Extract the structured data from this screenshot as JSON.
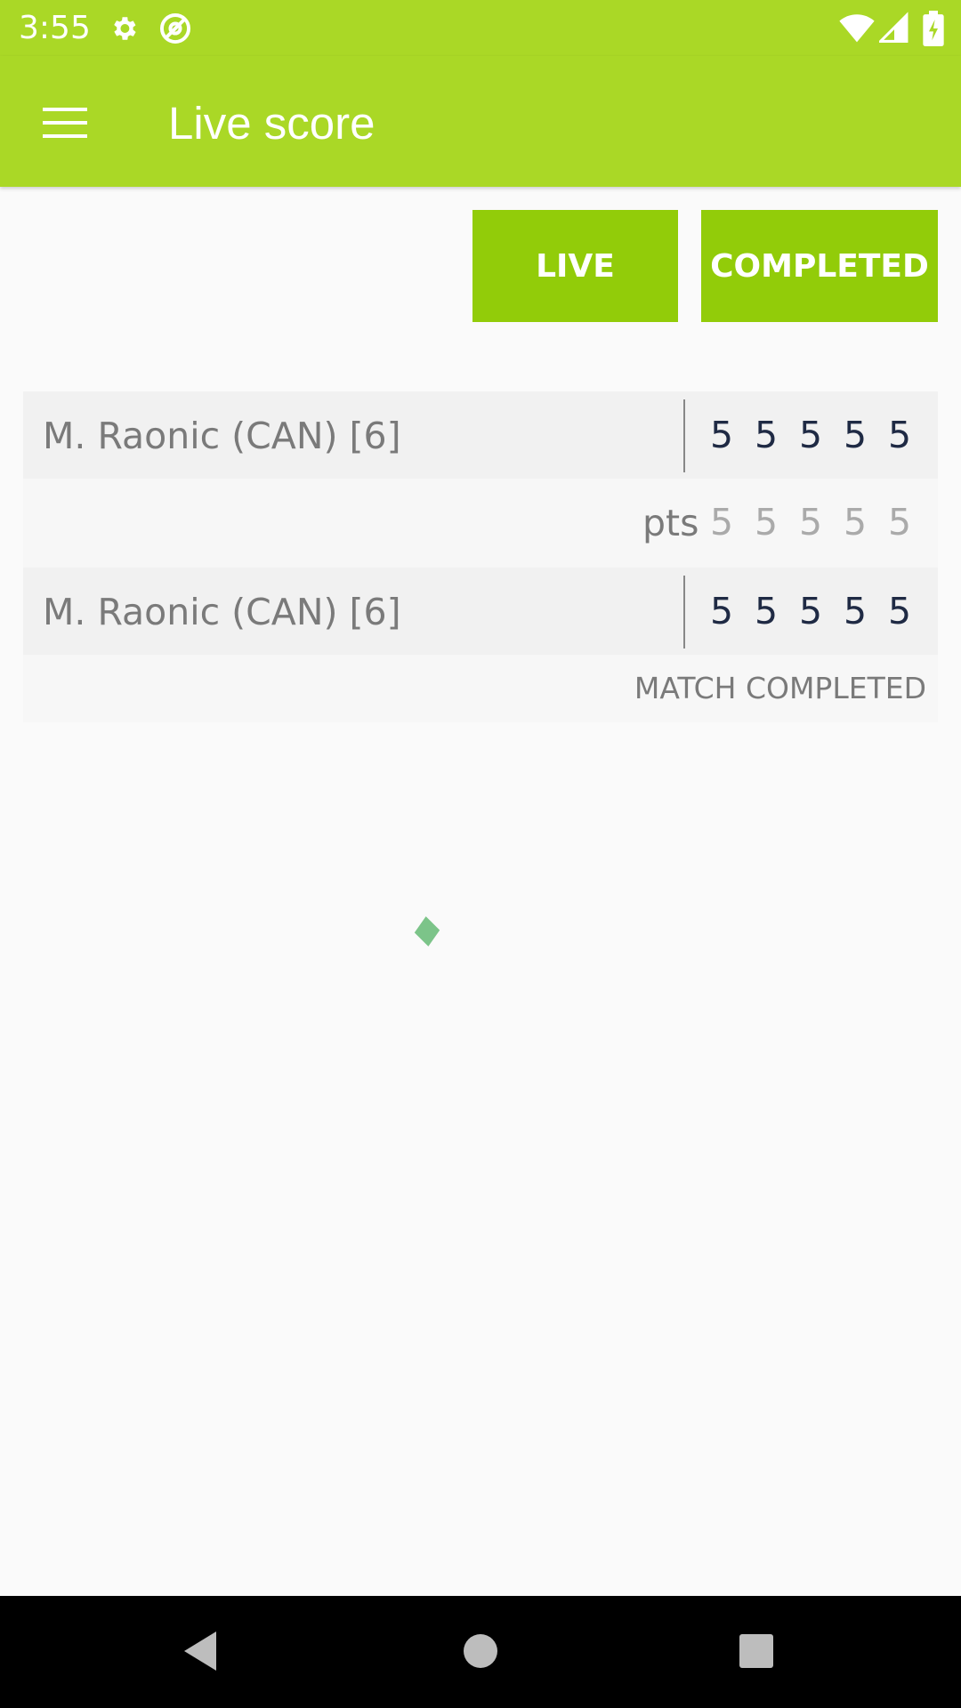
{
  "status_bar": {
    "time": "3:55",
    "icons": [
      "settings-icon",
      "at-sign-icon",
      "wifi-icon",
      "signal-icon",
      "battery-icon"
    ]
  },
  "app_bar": {
    "title": "Live score",
    "menu_icon": "hamburger-menu-icon"
  },
  "tabs": {
    "live_label": "LIVE",
    "completed_label": "COMPLETED"
  },
  "match": {
    "player1": {
      "name": "M. Raonic (CAN) [6]",
      "scores": [
        "5",
        "5",
        "5",
        "5",
        "5"
      ]
    },
    "points": {
      "label": "pts",
      "values": [
        "5",
        "5",
        "5",
        "5",
        "5"
      ]
    },
    "player2": {
      "name": "M. Raonic (CAN) [6]",
      "scores": [
        "5",
        "5",
        "5",
        "5",
        "5"
      ]
    },
    "status": "MATCH COMPLETED"
  },
  "nav_bar": {
    "back_icon": "back-triangle-icon",
    "home_icon": "home-circle-icon",
    "recents_icon": "recents-square-icon"
  },
  "colors": {
    "app_bar": "#aad826",
    "tab_button": "#92cc09",
    "score_text": "#1f2a44",
    "loader": "#7cc489"
  }
}
